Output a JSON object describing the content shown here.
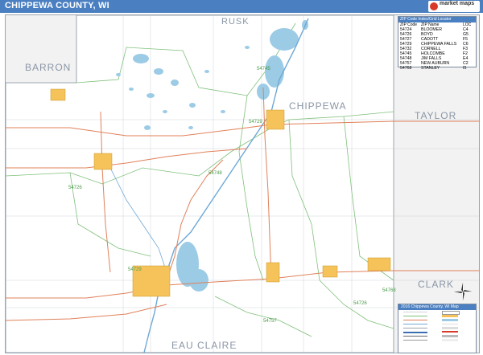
{
  "title": "CHIPPEWA COUNTY, WI",
  "brand": {
    "name": "market maps"
  },
  "colors": {
    "title_bar": "#4a7fc1",
    "map_bg": "#f2f2f2",
    "county_fill": "#ffffff",
    "water": "#9ccbe6",
    "zip_boundary": "#7fc07a",
    "highway": "#e0805a",
    "urban": "#f6c25a"
  },
  "neighbors": {
    "rusk": "RUSK",
    "barron": "BARRON",
    "chippewa": "CHIPPEWA",
    "taylor": "TAYLOR",
    "clark": "CLARK",
    "eau_claire": "EAU CLAIRE"
  },
  "zip_labels": {
    "z54745": "54745",
    "z54729": "54729",
    "z54726": "54726",
    "z54748": "54748",
    "z54729b": "54729",
    "z54768": "54768",
    "z54757": "54757",
    "z54726b": "54726"
  },
  "legend": {
    "header": "ZIP Code Index/Grid Locator",
    "columns": [
      "ZIP Code",
      "ZIP Name",
      "LOC"
    ],
    "rows": [
      {
        "zip": "54724",
        "name": "BLOOMER",
        "loc": "C4"
      },
      {
        "zip": "54726",
        "name": "BOYD",
        "loc": "G5"
      },
      {
        "zip": "54727",
        "name": "CADOTT",
        "loc": "F5"
      },
      {
        "zip": "54729",
        "name": "CHIPPEWA FALLS",
        "loc": "C6"
      },
      {
        "zip": "54732",
        "name": "CORNELL",
        "loc": "F3"
      },
      {
        "zip": "54745",
        "name": "HOLCOMBE",
        "loc": "F2"
      },
      {
        "zip": "54748",
        "name": "JIM FALLS",
        "loc": "E4"
      },
      {
        "zip": "54757",
        "name": "NEW AUBURN",
        "loc": "C2"
      },
      {
        "zip": "54768",
        "name": "STANLEY",
        "loc": "I5"
      }
    ]
  },
  "infobox": {
    "header": "2016 Chippewa County, WI Map"
  }
}
